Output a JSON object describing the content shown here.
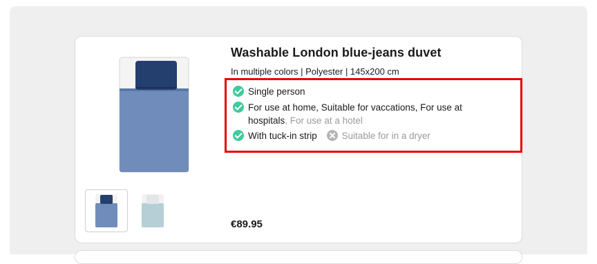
{
  "product": {
    "title": "Washable London blue-jeans duvet",
    "subtitle": "In multiple colors | Polyester | 145x200 cm",
    "price": "€89.95",
    "thumbnails": [
      {
        "name": "blue-jeans duvet",
        "selected": true
      },
      {
        "name": "light blue duvet",
        "selected": false
      }
    ]
  },
  "features": {
    "f1": "Single person",
    "f2_line1": "For use at home, Suitable for vaccations, For use at",
    "f2_line2": "hospitals",
    "f2_muted": ", For use at a hotel",
    "f3": "With tuck-in strip",
    "f3_unavailable": "Suitable for in a dryer"
  },
  "colors": {
    "check": "#3dcc9b",
    "cross": "#b5b5b5",
    "highlight": "#e60000",
    "duvet_blue": "#6f8cba",
    "pillow_navy": "#243e6e"
  },
  "icons": [
    "check-circle-icon",
    "x-circle-icon"
  ]
}
